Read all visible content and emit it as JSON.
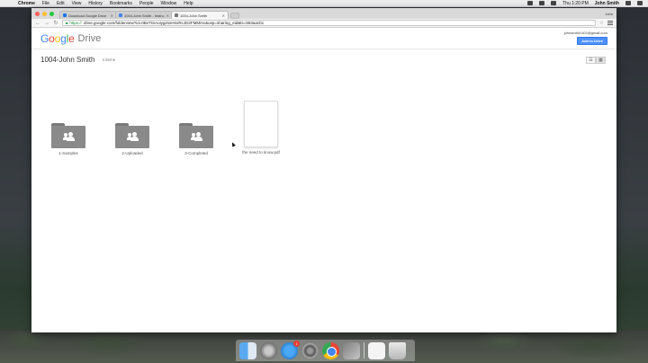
{
  "menubar": {
    "app": "Chrome",
    "items": [
      "File",
      "Edit",
      "View",
      "History",
      "Bookmarks",
      "People",
      "Window",
      "Help"
    ],
    "clock": "Thu 1:20 PM",
    "user": "John Smith"
  },
  "browser": {
    "tabs": [
      {
        "title": "Download Google Drive"
      },
      {
        "title": "1004-John Smith - Instru..."
      },
      {
        "title": "1004-John Smith"
      }
    ],
    "tab_user": "John",
    "url_scheme": "https://",
    "url": "drive.google.com/folderview?id=0BxTtSAoiyg2ssHnsRcJD2FMMmc&usp=sharing_eid&ts=563aacb1"
  },
  "drive": {
    "logo": {
      "g1": "G",
      "g2": "o",
      "g3": "o",
      "g4": "g",
      "g5": "l",
      "g6": "e",
      "product": "Drive"
    },
    "account_email": "johnsmith1402@gmail.com",
    "add_button": "Add to Drive",
    "folder_title": "1004-John Smith",
    "item_count": "4 items",
    "items": [
      {
        "label": "1-Samples",
        "type": "shared-folder"
      },
      {
        "label": "2-Uploaded",
        "type": "shared-folder"
      },
      {
        "label": "3-Completed",
        "type": "shared-folder"
      },
      {
        "label": "the need to know.pdf",
        "type": "pdf"
      }
    ]
  },
  "dock": {
    "appstore_badge": "1",
    "apps": [
      "finder",
      "launchpad",
      "app-store",
      "system-preferences",
      "chrome",
      "imovie",
      "document",
      "trash"
    ]
  }
}
